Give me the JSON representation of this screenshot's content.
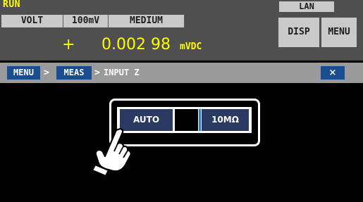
{
  "status": {
    "run": "RUN"
  },
  "params": {
    "function": "VOLT",
    "range": "100mV",
    "speed": "MEDIUM"
  },
  "lan": "LAN",
  "buttons": {
    "disp": "DISP",
    "menu": "MENU"
  },
  "reading": {
    "sign": "+",
    "value": "0.002 98",
    "unit": "mVDC"
  },
  "breadcrumb": {
    "root": "MENU",
    "separator": ">",
    "section": "MEAS",
    "current": "INPUT Z"
  },
  "close": {
    "symbol": "×"
  },
  "input_z": {
    "auto_label": "AUTO",
    "fixed_label": "10MΩ"
  },
  "icons": {
    "pointer": "hand-pointer-icon",
    "close": "close-icon"
  },
  "colors": {
    "reading": "#ffff00",
    "accent": "#1a4d8f",
    "toggle": "#2b3a63",
    "background": "#000000",
    "panel": "#4f4f4f"
  }
}
